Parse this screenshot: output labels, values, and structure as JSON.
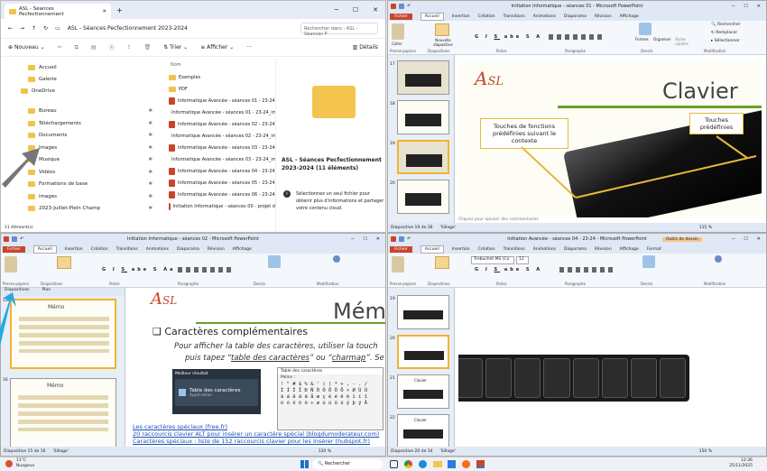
{
  "explorer": {
    "tab_title": "ASL - Séances Pecfectionnement",
    "breadcrumb": "ASL - Séances Pecfectionnement 2023-2024",
    "search_placeholder": "Rechercher dans : ASL - Séances P",
    "toolbar": {
      "new": "Nouveau",
      "sort": "Trier",
      "view": "Afficher",
      "more": "···",
      "details": "Détails"
    },
    "sidebar": [
      "Accueil",
      "Galerie",
      "OneDrive",
      "Bureau",
      "Téléchargements",
      "Documents",
      "Images",
      "Musique",
      "Vidéos",
      "Formations de base",
      "images",
      "2023-Juillet-Plein Champ"
    ],
    "list_header": "Nom",
    "files": [
      {
        "name": "Exemples",
        "type": "folder"
      },
      {
        "name": "PDF",
        "type": "folder"
      },
      {
        "name": "Informatique Avancée - séances 01 - 23-24",
        "type": "pptx"
      },
      {
        "name": "Informatique Avancée - séances 01 - 23-24_im",
        "type": "pptx"
      },
      {
        "name": "Informatique Avancée - séances 02 - 23-24",
        "type": "pptx"
      },
      {
        "name": "Informatique Avancée - séances 02 - 23-24_im",
        "type": "pptx"
      },
      {
        "name": "Informatique Avancée - séances 03 - 23-24",
        "type": "pptx"
      },
      {
        "name": "Informatique Avancée - séances 03 - 23-24_im",
        "type": "pptx"
      },
      {
        "name": "Informatique Avancée - séances 04 - 23-24",
        "type": "pptx"
      },
      {
        "name": "Informatique Avancée - séances 05 - 23-24",
        "type": "pptx"
      },
      {
        "name": "Informatique Avancée - séances 06 - 23-24",
        "type": "pptx"
      },
      {
        "name": "Initiation Informatique - séances 00 - projet d",
        "type": "pptx"
      }
    ],
    "detail_title": "ASL - Séances Pecfectionnement 2023-2024 (11 éléments)",
    "detail_msg": "Sélectionnez un seul fichier pour obtenir plus d'informations et partager votre contenu cloud.",
    "status": "11 élément(s)"
  },
  "ppt1": {
    "title": "Initiation Informatique - séances 01 - Microsoft PowerPoint",
    "tabs": [
      "Fichier",
      "Accueil",
      "Insertion",
      "Création",
      "Transitions",
      "Animations",
      "Diaporama",
      "Révision",
      "Affichage"
    ],
    "groups": [
      "Presse-papiers",
      "Diapositives",
      "Police",
      "Paragraphe",
      "Dessin",
      "Modification"
    ],
    "ribbon": {
      "paste": "Coller",
      "new_slide": "Nouvelle diapositive",
      "find": "Rechercher",
      "replace": "Remplacer",
      "select": "Sélectionner",
      "shapes": "Formes",
      "arrange": "Organiser",
      "styles": "Styles rapides"
    },
    "thumb_nums": [
      "17",
      "18",
      "19",
      "20"
    ],
    "slide_title": "Clavier",
    "callout1": "Touches de fonctions prédéfinies suivant le contexte",
    "callout2": "Touches prédéfinies",
    "notes": "Cliquez pour ajouter des commentaires",
    "status": "Diapositive 19 de 36",
    "theme": "'Sillage'",
    "zoom": "115 %"
  },
  "ppt2": {
    "title": "Initiation Informatique - séances 02 - Microsoft PowerPoint",
    "tabs": [
      "Fichier",
      "Accueil",
      "Insertion",
      "Création",
      "Transitions",
      "Animations",
      "Diaporama",
      "Révision",
      "Affichage"
    ],
    "panel_tabs": [
      "Diapositives",
      "Plan"
    ],
    "thumb_nums": [
      "15",
      "16"
    ],
    "thumb_titles": [
      "Mémo",
      "Mémo"
    ],
    "slide_title": "Mém",
    "bullet": "Caractères complémentaires",
    "text": "Pour afficher la table des caractères, utiliser la touch",
    "text2_pre": "puis tapez “",
    "link1": "table des caractères",
    "text2_mid": "” ou “",
    "link2": "charmap",
    "text2_post": "”. Se",
    "search_best": "Meilleur résultat",
    "search_app": "Table des caractères",
    "search_sub": "Application",
    "charmap_title": "Table des caractères",
    "charmap_label": "Police :",
    "charmap_rows": [
      "! \" # $ % & ' ( ) * + , - . /",
      "Ì Í Î Ï Ð Ñ Ò Ó Ô Õ Ö × Ø Ù Ú",
      "à á â ã ä å æ ç è é ê ë ì í î",
      "ò ó ô õ ö ÷ ø ù ú û ü ý þ ÿ Ā"
    ],
    "links": [
      "Les caractères spéciaux (free.fr)",
      "20 raccourcis clavier ALT pour insérer un caractère spécial (blogdumoderateur.com)",
      "Caractères spéciaux : liste de 152 raccourcis clavier pour les insérer (hubspot.fr)"
    ],
    "status": "Diapositive 15 de 16",
    "theme": "'Sillage'",
    "zoom": "120 %"
  },
  "ppt3": {
    "title": "Initiation Avancée - séances 04 - 23-24 - Microsoft PowerPoint",
    "context_tab": "Outils de dessin",
    "tabs": [
      "Fichier",
      "Accueil",
      "Insertion",
      "Création",
      "Transitions",
      "Animations",
      "Diaporama",
      "Révision",
      "Affichage",
      "Format"
    ],
    "font": "Trebuchet MS (Co",
    "size": "12",
    "thumb_nums": [
      "19",
      "20",
      "21",
      "22"
    ],
    "thumb_labels": [
      "",
      "",
      "Clavier",
      "Clavier"
    ],
    "status": "Diapositive 20 de 34",
    "theme": "'Sillage'",
    "zoom": "150 %"
  },
  "taskbar": {
    "temp": "11°C",
    "weather": "Nuageux",
    "search": "Rechercher",
    "time": "12:36",
    "date": "25/11/2025"
  }
}
